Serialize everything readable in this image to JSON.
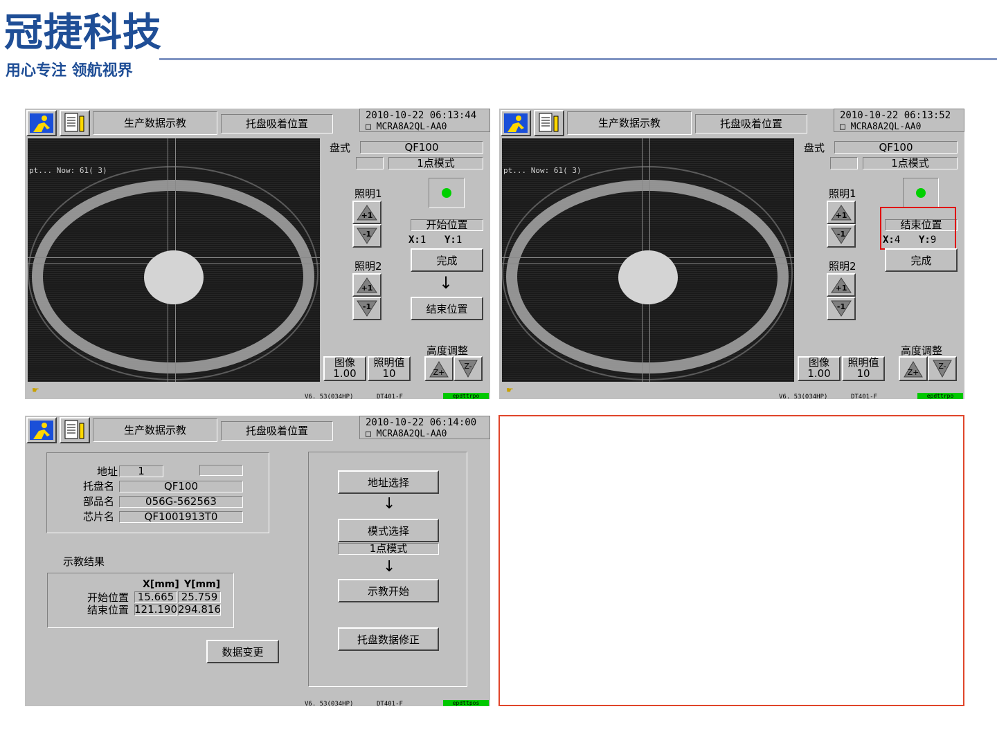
{
  "brand": {
    "title": "冠捷科技",
    "slogan": "用心专注 领航视界"
  },
  "panels": [
    {
      "header": {
        "title": "生产数据示教",
        "subtitle": "托盘吸着位置",
        "datetime": "2010-10-22  06:13:44",
        "model": "MCRA8A2QL-AA0"
      },
      "camera": {
        "overlay": "pt...   Now: 61(  3)"
      },
      "tray": {
        "label": "盘式",
        "value": "QF100",
        "mode": "1点模式"
      },
      "light1": "照明1",
      "light2": "照明2",
      "plus": "+1",
      "minus": "-1",
      "position": {
        "label": "开始位置",
        "x_label": "X:",
        "x": "1",
        "y_label": "Y:",
        "y": "1"
      },
      "done": "完成",
      "arrow": "↓",
      "end_button": "结束位置",
      "image": {
        "label": "图像",
        "value": "1.00"
      },
      "lightval": {
        "label": "照明值",
        "value": "10"
      },
      "height": {
        "label": "高度调整",
        "z_plus": "Z+",
        "z_minus": "Z-"
      },
      "status": {
        "version": "V6. 53(034HP)",
        "code": "DT401-F",
        "flags": "epdttrpo"
      }
    },
    {
      "header": {
        "title": "生产数据示教",
        "subtitle": "托盘吸着位置",
        "datetime": "2010-10-22  06:13:52",
        "model": "MCRA8A2QL-AA0"
      },
      "camera": {
        "overlay": "pt...   Now: 61(  3)"
      },
      "tray": {
        "label": "盘式",
        "value": "QF100",
        "mode": "1点模式"
      },
      "light1": "照明1",
      "light2": "照明2",
      "plus": "+1",
      "minus": "-1",
      "position": {
        "label": "结束位置",
        "x_label": "X:",
        "x": "4",
        "y_label": "Y:",
        "y": "9"
      },
      "done": "完成",
      "image": {
        "label": "图像",
        "value": "1.00"
      },
      "lightval": {
        "label": "照明值",
        "value": "10"
      },
      "height": {
        "label": "高度调整",
        "z_plus": "Z+",
        "z_minus": "Z-"
      },
      "status": {
        "version": "V6. 53(034HP)",
        "code": "DT401-F",
        "flags": "epdttrpo"
      }
    }
  ],
  "panel3": {
    "header": {
      "title": "生产数据示教",
      "subtitle": "托盘吸着位置",
      "datetime": "2010-10-22  06:14:00",
      "model": "MCRA8A2QL-AA0"
    },
    "info": [
      {
        "label": "地址",
        "value": "1"
      },
      {
        "label": "托盘名",
        "value": "QF100"
      },
      {
        "label": "部品名",
        "value": "056G-562563"
      },
      {
        "label": "芯片名",
        "value": "QF1001913T0"
      }
    ],
    "result_title": "示教结果",
    "result": {
      "col_x": "X[mm]",
      "col_y": "Y[mm]",
      "rows": [
        {
          "label": "开始位置",
          "x": "15.665",
          "y": "25.759"
        },
        {
          "label": "结束位置",
          "x": "121.190",
          "y": "294.816"
        }
      ]
    },
    "data_change": "数据变更",
    "steps": {
      "address": "地址选择",
      "mode": "模式选择",
      "mode_value": "1点模式",
      "start": "示教开始",
      "fix": "托盘数据修正",
      "arrow": "↓"
    },
    "status": {
      "version": "V6. 53(034HP)",
      "code": "DT401-F",
      "flags": "epdttpos"
    }
  },
  "colors": {
    "panel_bg": "#c0c0c0",
    "brand_blue": "#1f4e96",
    "highlight_red": "#e01010",
    "status_green": "#00c800",
    "empty_border": "#e0452a"
  }
}
